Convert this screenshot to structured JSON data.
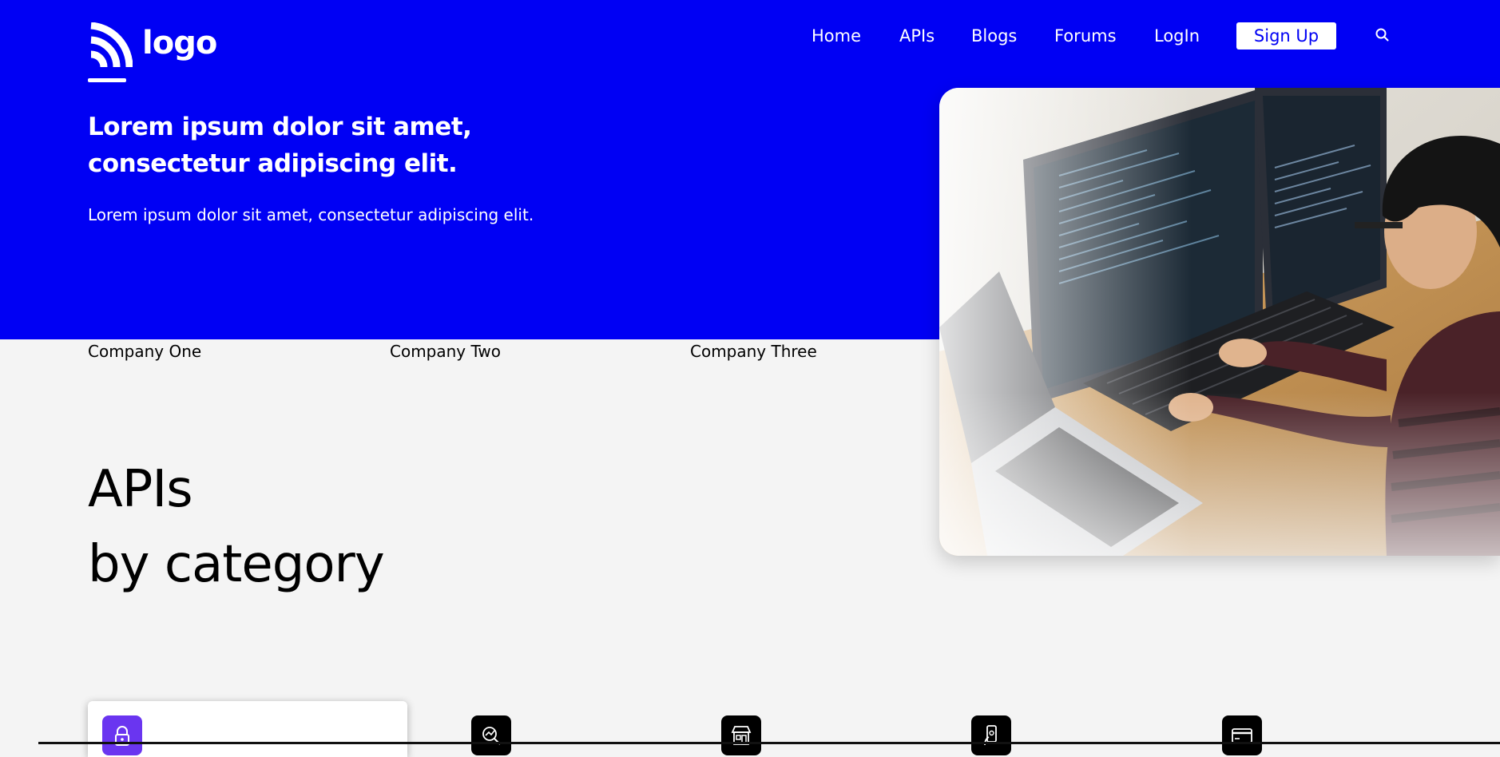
{
  "brand": {
    "logo_text": "logo"
  },
  "nav": {
    "items": [
      "Home",
      "APIs",
      "Blogs",
      "Forums",
      "LogIn"
    ],
    "signup": "Sign Up",
    "search_icon": "search-icon"
  },
  "hero": {
    "title": "Lorem ipsum dolor sit amet, consectetur adipiscing elit.",
    "subtitle": "Lorem ipsum dolor sit amet, consectetur adipiscing elit."
  },
  "companies": [
    "Company One",
    "Company Two",
    "Company Three"
  ],
  "section": {
    "line1": "APIs",
    "line2": "by category"
  },
  "categories": [
    {
      "icon": "lock-icon"
    },
    {
      "icon": "magnifier-chart-icon"
    },
    {
      "icon": "storefront-icon"
    },
    {
      "icon": "mobile-pay-icon"
    },
    {
      "icon": "credit-card-icon"
    }
  ],
  "colors": {
    "primary": "#0000f4",
    "background": "#f4f4f4",
    "accent": "#6a35f0"
  }
}
